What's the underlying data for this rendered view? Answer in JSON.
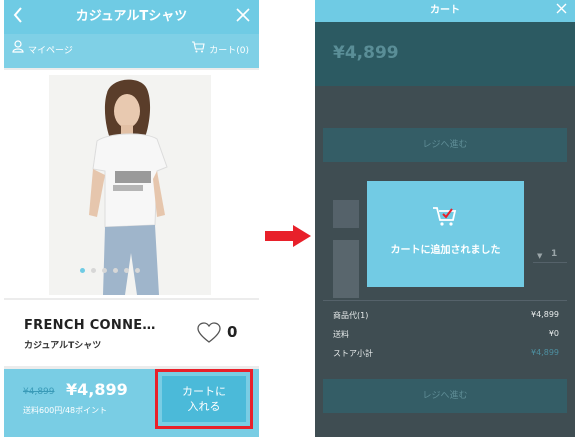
{
  "left": {
    "header": {
      "title": "カジュアルTシャツ",
      "back_icon": "chevron-left-icon",
      "close_icon": "close-icon"
    },
    "subnav": {
      "mypage_label": "マイページ",
      "cart_label": "カート(0)"
    },
    "carousel": {
      "slide_count": 6,
      "active_index": 0
    },
    "product": {
      "name": "FRENCH CONNE…",
      "category": "カジュアルTシャツ",
      "favorite_count": "0"
    },
    "buy": {
      "old_price": "¥4,899",
      "price": "¥4,899",
      "shipping_note": "送料600円/48ポイント",
      "add_to_cart_line1": "カートに",
      "add_to_cart_line2": "入れる"
    }
  },
  "right": {
    "header": {
      "title": "カート",
      "close_icon": "close-icon"
    },
    "summary": {
      "total": "¥4,899"
    },
    "checkout_label": "レジへ進む",
    "qty": "1",
    "rows": [
      {
        "label": "商品代(1)",
        "value": "¥4,899"
      },
      {
        "label": "送料",
        "value": "¥0"
      },
      {
        "label": "ストア小計",
        "value": "¥4,899"
      }
    ],
    "modal": {
      "message": "カートに追加されました",
      "icon": "cart-check-icon"
    }
  },
  "colors": {
    "header": "#6fcbe4",
    "button": "#4bbad9",
    "highlight_border": "#e8202a",
    "arrow": "#e8202a",
    "overlay": "#3f4d52"
  }
}
